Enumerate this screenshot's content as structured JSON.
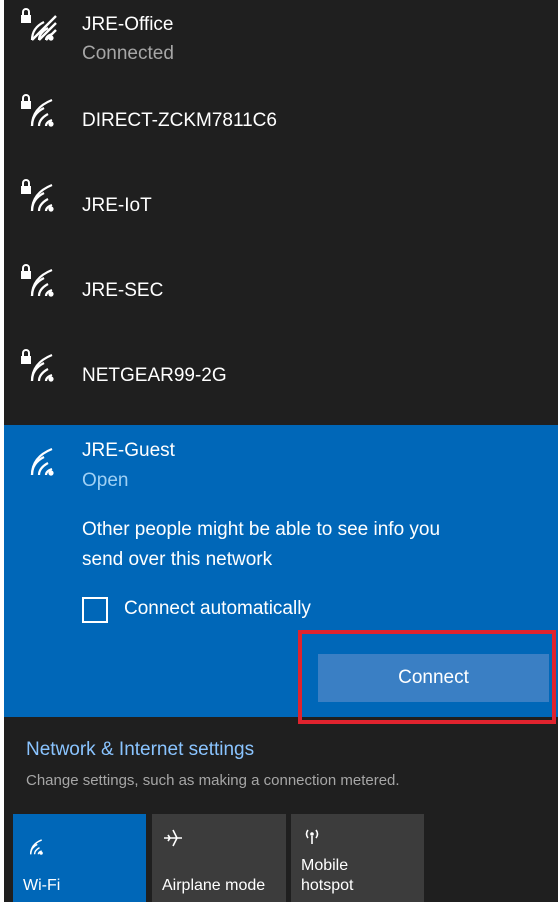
{
  "networks": [
    {
      "name": "JRE-Office",
      "status": "Connected",
      "secured": true
    },
    {
      "name": "DIRECT-ZCKM7811C6",
      "secured": true
    },
    {
      "name": "JRE-IoT",
      "secured": true
    },
    {
      "name": "JRE-SEC",
      "secured": true
    },
    {
      "name": "NETGEAR99-2G",
      "secured": true
    }
  ],
  "selected_network": {
    "name": "JRE-Guest",
    "status": "Open",
    "warning_line1": "Other people might be able to see info you",
    "warning_line2": "send over this network",
    "connect_automatically_label": "Connect automatically",
    "connect_automatically_checked": false,
    "connect_button": "Connect"
  },
  "settings": {
    "title": "Network & Internet settings",
    "subtitle": "Change settings, such as making a connection metered."
  },
  "quick_actions": [
    {
      "label": "Wi-Fi",
      "icon": "wifi-icon",
      "active": true
    },
    {
      "label": "Airplane mode",
      "icon": "airplane-icon",
      "active": false
    },
    {
      "label_line1": "Mobile",
      "label_line2": "hotspot",
      "icon": "hotspot-icon",
      "active": false
    }
  ],
  "colors": {
    "panel_bg": "#1f1f1f",
    "selected_bg": "#0067b8",
    "accent_link": "#8ac4ff",
    "highlight_border": "#e0232e"
  }
}
